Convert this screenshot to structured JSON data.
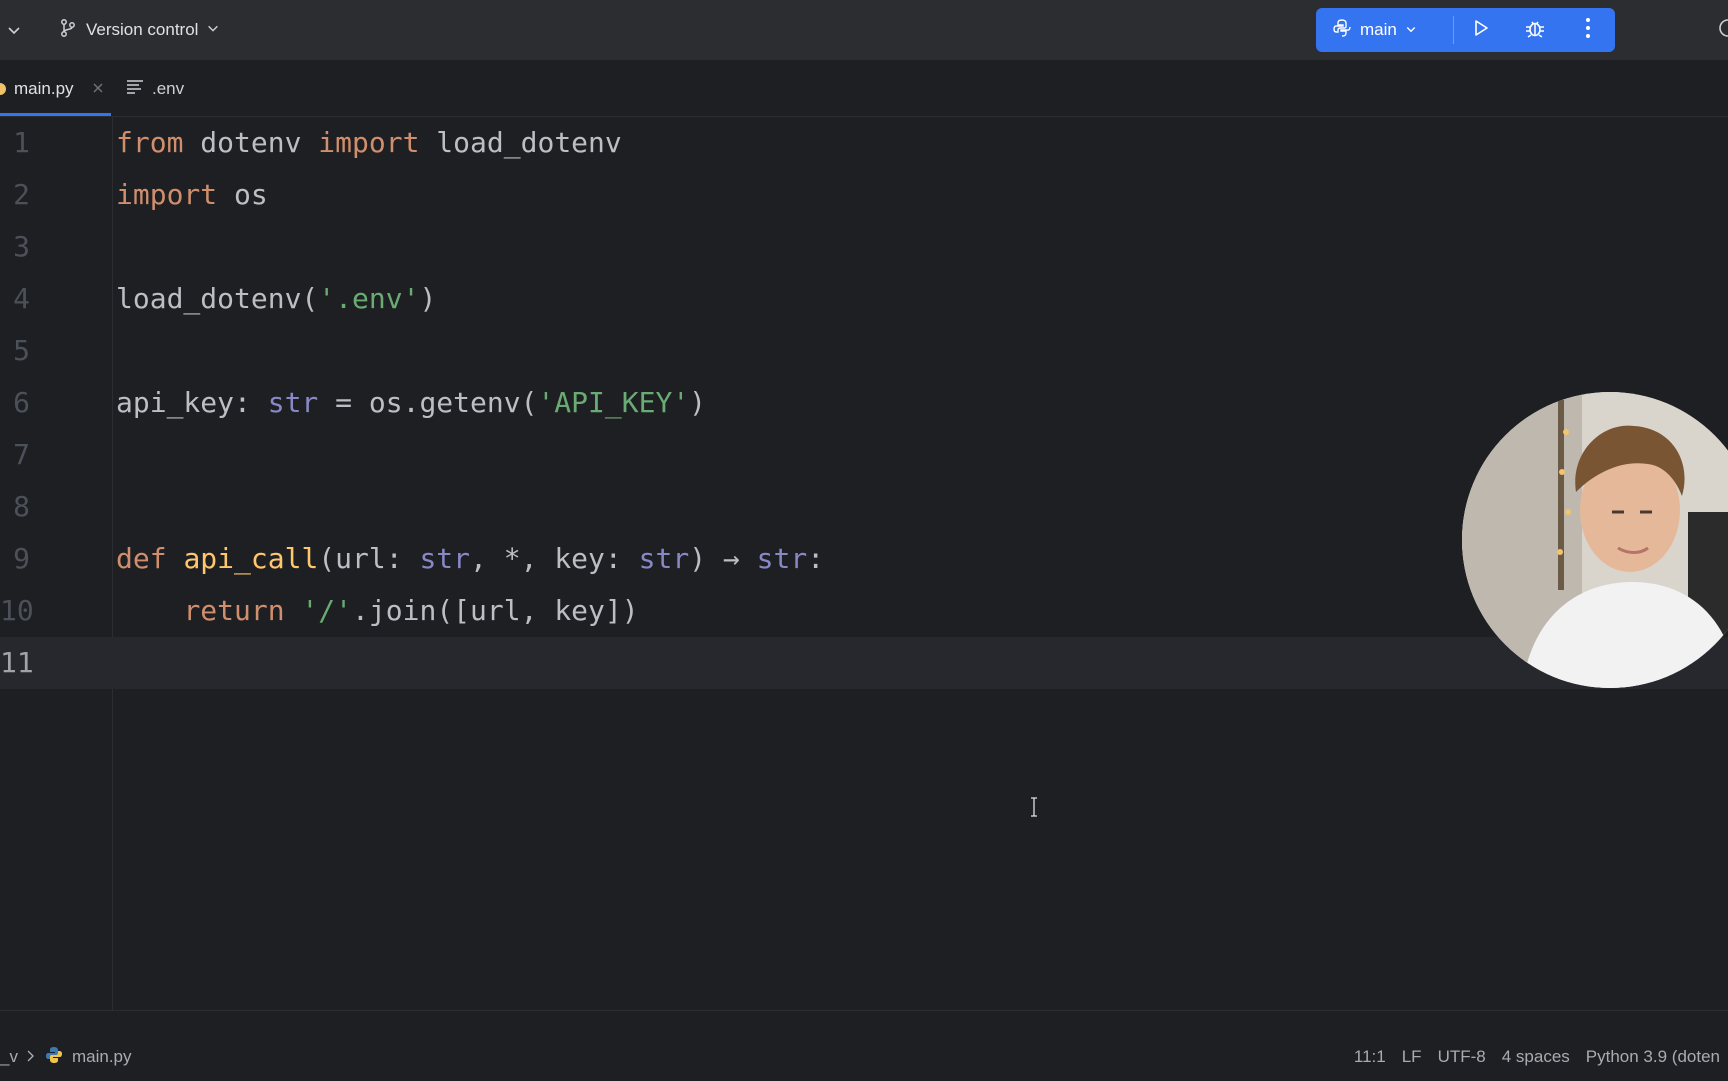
{
  "toolbar": {
    "vcs_label": "Version control",
    "run_config": "main",
    "icons": [
      "chevron-down-icon",
      "branch-icon",
      "python-icon",
      "run-icon",
      "debug-icon",
      "more-vertical-icon"
    ]
  },
  "tabs": [
    {
      "label": "main.py",
      "active": true
    },
    {
      "label": ".env",
      "active": false
    }
  ],
  "editor": {
    "current_line": 11,
    "lines": [
      {
        "num": "1"
      },
      {
        "num": "2"
      },
      {
        "num": "3"
      },
      {
        "num": "4"
      },
      {
        "num": "5"
      },
      {
        "num": "6"
      },
      {
        "num": "7"
      },
      {
        "num": "8"
      },
      {
        "num": "9"
      },
      {
        "num": "10"
      },
      {
        "num": "11"
      }
    ],
    "tokens": {
      "l1": [
        "from",
        " dotenv ",
        "import",
        " load_dotenv"
      ],
      "l2": [
        "import",
        " os"
      ],
      "l4": [
        "load_dotenv(",
        "'.env'",
        ")"
      ],
      "l6": [
        "api_key: ",
        "str",
        " = os.getenv(",
        "'API_KEY'",
        ")"
      ],
      "l9": [
        "def",
        " ",
        "api_call",
        "(url: ",
        "str",
        ", *, key: ",
        "str",
        ") ",
        "→",
        " ",
        "str",
        ":"
      ],
      "l10": [
        "    ",
        "return",
        " ",
        "'/'",
        ".join([url, key])"
      ]
    }
  },
  "statusbar": {
    "breadcrumb_root": "_v",
    "file": "main.py",
    "position": "11:1",
    "line_separator": "LF",
    "encoding": "UTF-8",
    "indent": "4 spaces",
    "interpreter": "Python 3.9 (doten"
  },
  "colors": {
    "accent": "#3574f0",
    "keyword": "#cf8e6d",
    "string": "#6aab73",
    "function_def": "#ffc66d",
    "builtin": "#8888c6",
    "background": "#1e1f22"
  }
}
